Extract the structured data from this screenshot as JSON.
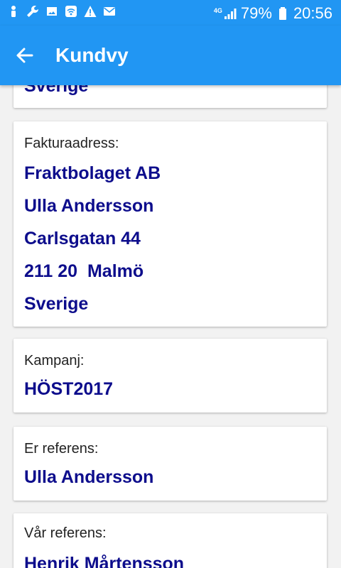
{
  "status_bar": {
    "left_icons": [
      "person-icon",
      "wrench-icon",
      "image-icon",
      "wifi-icon",
      "warning-icon",
      "mail-icon"
    ],
    "network": "4G",
    "battery": "79%",
    "time": "20:56"
  },
  "app_bar": {
    "title": "Kundvy"
  },
  "cards": {
    "partial": {
      "value": "Sverige"
    },
    "invoice": {
      "label": "Fakturaadress:",
      "lines": [
        "Fraktbolaget AB",
        "Ulla Andersson",
        "Carlsgatan 44",
        "211 20  Malmö",
        "Sverige"
      ]
    },
    "campaign": {
      "label": "Kampanj:",
      "value": "HÖST2017"
    },
    "your_ref": {
      "label": "Er referens:",
      "value": "Ulla Andersson"
    },
    "our_ref": {
      "label": "Vår referens:",
      "value": "Henrik Mårtensson"
    }
  },
  "colors": {
    "primary": "#2196f3",
    "value_text": "#0d0d8c",
    "background": "#f2f2f2"
  }
}
